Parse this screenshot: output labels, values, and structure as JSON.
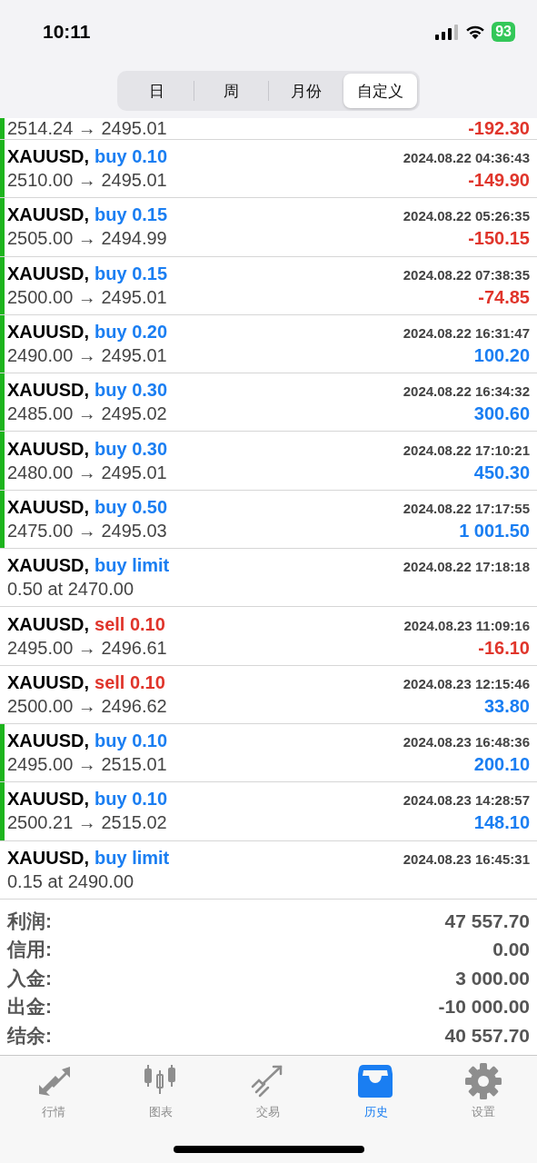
{
  "status_bar": {
    "time": "10:11",
    "battery": "93"
  },
  "period_tabs": [
    {
      "label": "日",
      "selected": false
    },
    {
      "label": "周",
      "selected": false
    },
    {
      "label": "月份",
      "selected": false
    },
    {
      "label": "自定义",
      "selected": true
    }
  ],
  "history": [
    {
      "kind": "tail",
      "marker": true,
      "detail": "2514.24 → 2495.01",
      "profit": "-192.30",
      "loss": true
    },
    {
      "kind": "deal",
      "marker": true,
      "symbol": "XAUUSD,",
      "sell": false,
      "order": "buy 0.10",
      "time": "2024.08.22 04:36:43",
      "detail": "2510.00 → 2495.01",
      "profit": "-149.90",
      "loss": true
    },
    {
      "kind": "deal",
      "marker": true,
      "symbol": "XAUUSD,",
      "sell": false,
      "order": "buy 0.15",
      "time": "2024.08.22 05:26:35",
      "detail": "2505.00 → 2494.99",
      "profit": "-150.15",
      "loss": true
    },
    {
      "kind": "deal",
      "marker": true,
      "symbol": "XAUUSD,",
      "sell": false,
      "order": "buy 0.15",
      "time": "2024.08.22 07:38:35",
      "detail": "2500.00 → 2495.01",
      "profit": "-74.85",
      "loss": true
    },
    {
      "kind": "deal",
      "marker": true,
      "symbol": "XAUUSD,",
      "sell": false,
      "order": "buy 0.20",
      "time": "2024.08.22 16:31:47",
      "detail": "2490.00 → 2495.01",
      "profit": "100.20",
      "loss": false
    },
    {
      "kind": "deal",
      "marker": true,
      "symbol": "XAUUSD,",
      "sell": false,
      "order": "buy 0.30",
      "time": "2024.08.22 16:34:32",
      "detail": "2485.00 → 2495.02",
      "profit": "300.60",
      "loss": false
    },
    {
      "kind": "deal",
      "marker": true,
      "symbol": "XAUUSD,",
      "sell": false,
      "order": "buy 0.30",
      "time": "2024.08.22 17:10:21",
      "detail": "2480.00 → 2495.01",
      "profit": "450.30",
      "loss": false
    },
    {
      "kind": "deal",
      "marker": true,
      "symbol": "XAUUSD,",
      "sell": false,
      "order": "buy 0.50",
      "time": "2024.08.22 17:17:55",
      "detail": "2475.00 → 2495.03",
      "profit": "1 001.50",
      "loss": false
    },
    {
      "kind": "order",
      "marker": false,
      "symbol": "XAUUSD,",
      "sell": false,
      "order": "buy limit",
      "time": "2024.08.22 17:18:18",
      "detail": "0.50 at 2470.00"
    },
    {
      "kind": "deal",
      "marker": false,
      "symbol": "XAUUSD,",
      "sell": true,
      "order": "sell 0.10",
      "time": "2024.08.23 11:09:16",
      "detail": "2495.00 → 2496.61",
      "profit": "-16.10",
      "loss": true
    },
    {
      "kind": "deal",
      "marker": false,
      "symbol": "XAUUSD,",
      "sell": true,
      "order": "sell 0.10",
      "time": "2024.08.23 12:15:46",
      "detail": "2500.00 → 2496.62",
      "profit": "33.80",
      "loss": false
    },
    {
      "kind": "deal",
      "marker": true,
      "symbol": "XAUUSD,",
      "sell": false,
      "order": "buy 0.10",
      "time": "2024.08.23 16:48:36",
      "detail": "2495.00 → 2515.01",
      "profit": "200.10",
      "loss": false
    },
    {
      "kind": "deal",
      "marker": true,
      "symbol": "XAUUSD,",
      "sell": false,
      "order": "buy 0.10",
      "time": "2024.08.23 14:28:57",
      "detail": "2500.21 → 2515.02",
      "profit": "148.10",
      "loss": false
    },
    {
      "kind": "order",
      "marker": false,
      "symbol": "XAUUSD,",
      "sell": false,
      "order": "buy limit",
      "time": "2024.08.23 16:45:31",
      "detail": "0.15 at 2490.00"
    }
  ],
  "summary": [
    {
      "label": "利润:",
      "value": "47 557.70"
    },
    {
      "label": "信用:",
      "value": "0.00"
    },
    {
      "label": "入金:",
      "value": "3 000.00"
    },
    {
      "label": "出金:",
      "value": "-10 000.00"
    },
    {
      "label": "结余:",
      "value": "40 557.70"
    }
  ],
  "tab_bar": [
    {
      "kind": "quotes",
      "label": "行情",
      "selected": false
    },
    {
      "kind": "chart",
      "label": "图表",
      "selected": false
    },
    {
      "kind": "trade",
      "label": "交易",
      "selected": false
    },
    {
      "kind": "history",
      "label": "历史",
      "selected": true
    },
    {
      "kind": "settings",
      "label": "设置",
      "selected": false
    }
  ]
}
